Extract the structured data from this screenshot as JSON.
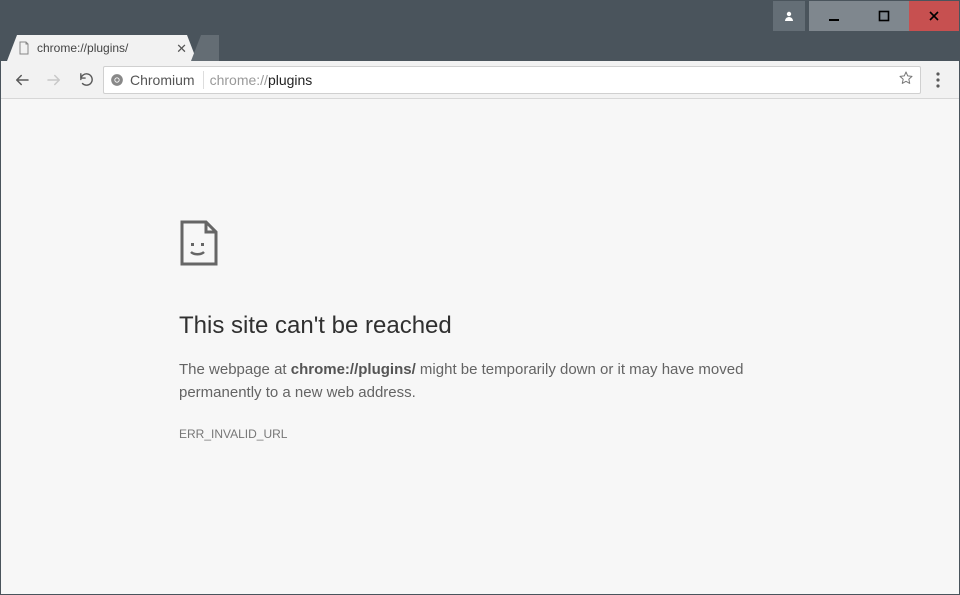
{
  "window": {
    "user_icon": "user-icon",
    "minimize": "minimize",
    "maximize": "maximize",
    "close": "close"
  },
  "tab": {
    "title": "chrome://plugins/"
  },
  "omnibox": {
    "security_label": "Chromium",
    "url_scheme": "chrome://",
    "url_path": "plugins"
  },
  "error": {
    "title": "This site can't be reached",
    "msg_prefix": "The webpage at ",
    "msg_url": "chrome://plugins/",
    "msg_suffix": " might be temporarily down or it may have moved permanently to a new web address.",
    "code": "ERR_INVALID_URL"
  }
}
